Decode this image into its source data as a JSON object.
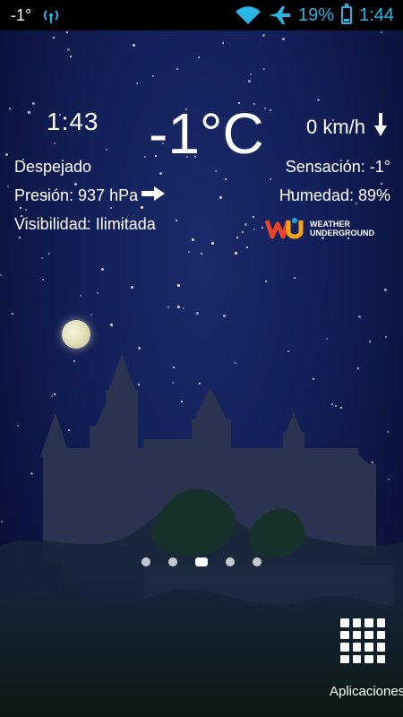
{
  "status_bar": {
    "temperature": "-1°",
    "battery": "19%",
    "time": "1:44",
    "battery_level": 0.19,
    "icons": [
      "wifi-icon",
      "airplane-icon",
      "battery-icon",
      "signal-broadcast-icon"
    ],
    "accent_color": "#29b6e6"
  },
  "weather_widget": {
    "clock": "1:43",
    "temperature": "-1°C",
    "wind": "0 km/h",
    "condition": "Despejado",
    "pressure": "Presión: 937 hPa",
    "visibility": "Visibilidad: Ilimitada",
    "feels_like": "Sensación: -1°",
    "humidity": "Humedad: 89%",
    "provider_logo_text": "WEATHER UNDERGROUND"
  },
  "home": {
    "page_indicator_count": 5,
    "page_indicator_active": 3,
    "apps_label": "Aplicaciones"
  }
}
